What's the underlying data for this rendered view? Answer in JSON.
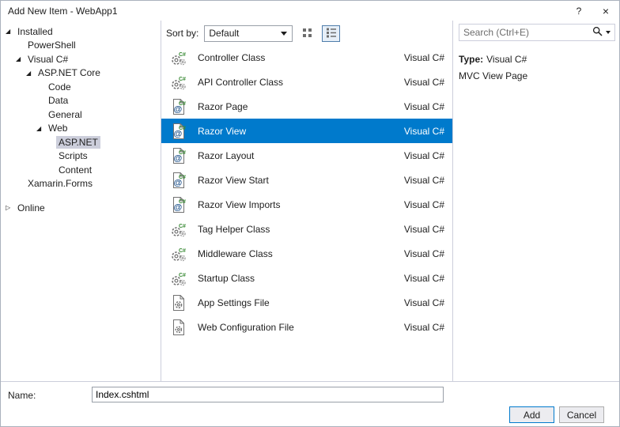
{
  "window": {
    "title": "Add New Item - WebApp1"
  },
  "icons": {
    "help": "?",
    "close": "×",
    "expanded": "◢",
    "collapsed": "▷",
    "search": "magnifier",
    "view_small": "small-icons-grid",
    "view_list": "list-lines"
  },
  "colors": {
    "accent": "#007ACC",
    "tree_selection": "#CCCEDB",
    "badge_green": "#388A34"
  },
  "tree": {
    "items": [
      {
        "label": "Installed",
        "level": 0,
        "expander": "expanded"
      },
      {
        "label": "PowerShell",
        "level": 1
      },
      {
        "label": "Visual C#",
        "level": 1,
        "expander": "expanded"
      },
      {
        "label": "ASP.NET Core",
        "level": 2,
        "expander": "expanded"
      },
      {
        "label": "Code",
        "level": 3
      },
      {
        "label": "Data",
        "level": 3
      },
      {
        "label": "General",
        "level": 3
      },
      {
        "label": "Web",
        "level": 3,
        "expander": "expanded"
      },
      {
        "label": "ASP.NET",
        "level": 4,
        "selected": true
      },
      {
        "label": "Scripts",
        "level": 4
      },
      {
        "label": "Content",
        "level": 4
      },
      {
        "label": "Xamarin.Forms",
        "level": 1
      },
      {
        "label": "Online",
        "level": 0,
        "expander": "collapsed",
        "gap_before": true
      }
    ]
  },
  "sortbar": {
    "label": "Sort by:",
    "selected": "Default"
  },
  "search": {
    "placeholder": "Search (Ctrl+E)"
  },
  "list": {
    "items": [
      {
        "name": "Controller Class",
        "language": "Visual C#",
        "icon": "csharp-class-icon"
      },
      {
        "name": "API Controller Class",
        "language": "Visual C#",
        "icon": "csharp-class-icon"
      },
      {
        "name": "Razor Page",
        "language": "Visual C#",
        "icon": "razor-file-icon"
      },
      {
        "name": "Razor View",
        "language": "Visual C#",
        "icon": "razor-file-icon",
        "selected": true
      },
      {
        "name": "Razor Layout",
        "language": "Visual C#",
        "icon": "razor-file-icon"
      },
      {
        "name": "Razor View Start",
        "language": "Visual C#",
        "icon": "razor-file-icon"
      },
      {
        "name": "Razor View Imports",
        "language": "Visual C#",
        "icon": "razor-file-icon"
      },
      {
        "name": "Tag Helper Class",
        "language": "Visual C#",
        "icon": "csharp-class-icon"
      },
      {
        "name": "Middleware Class",
        "language": "Visual C#",
        "icon": "csharp-class-icon"
      },
      {
        "name": "Startup Class",
        "language": "Visual C#",
        "icon": "csharp-class-icon"
      },
      {
        "name": "App Settings File",
        "language": "Visual C#",
        "icon": "settings-file-icon"
      },
      {
        "name": "Web Configuration File",
        "language": "Visual C#",
        "icon": "config-file-icon"
      }
    ]
  },
  "details": {
    "type_label": "Type:",
    "type_value": "Visual C#",
    "description": "MVC View Page"
  },
  "footer": {
    "name_label": "Name:",
    "name_value": "Index.cshtml",
    "add_label": "Add",
    "cancel_label": "Cancel"
  }
}
